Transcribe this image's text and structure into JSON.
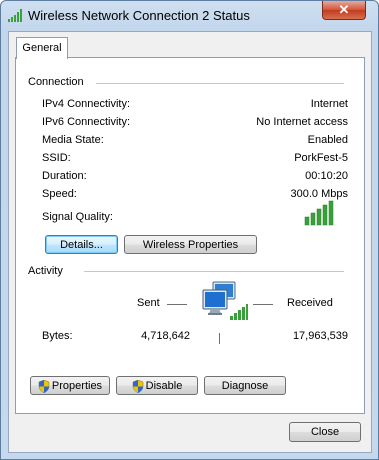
{
  "window": {
    "title": "Wireless Network Connection 2 Status",
    "close_label": "✕"
  },
  "tabs": [
    {
      "label": "General"
    }
  ],
  "connection": {
    "group_label": "Connection",
    "rows": [
      {
        "label": "IPv4 Connectivity:",
        "value": "Internet"
      },
      {
        "label": "IPv6 Connectivity:",
        "value": "No Internet access"
      },
      {
        "label": "Media State:",
        "value": "Enabled"
      },
      {
        "label": "SSID:",
        "value": "PorkFest-5"
      },
      {
        "label": "Duration:",
        "value": "00:10:20"
      },
      {
        "label": "Speed:",
        "value": "300.0 Mbps"
      }
    ],
    "signal_label": "Signal Quality:",
    "signal_bars_lit": 5,
    "signal_bars_total": 5,
    "details_button": "Details...",
    "wireless_properties_button": "Wireless Properties"
  },
  "activity": {
    "group_label": "Activity",
    "sent_label": "Sent",
    "received_label": "Received",
    "bytes_label": "Bytes:",
    "bytes_sent": "4,718,642",
    "bytes_received": "17,963,539"
  },
  "buttons": {
    "properties": "Properties",
    "disable": "Disable",
    "diagnose": "Diagnose",
    "close": "Close"
  },
  "colors": {
    "signal": "#3aa13a",
    "close_button": "#c7432a",
    "focus_border": "#3c7fb1"
  }
}
